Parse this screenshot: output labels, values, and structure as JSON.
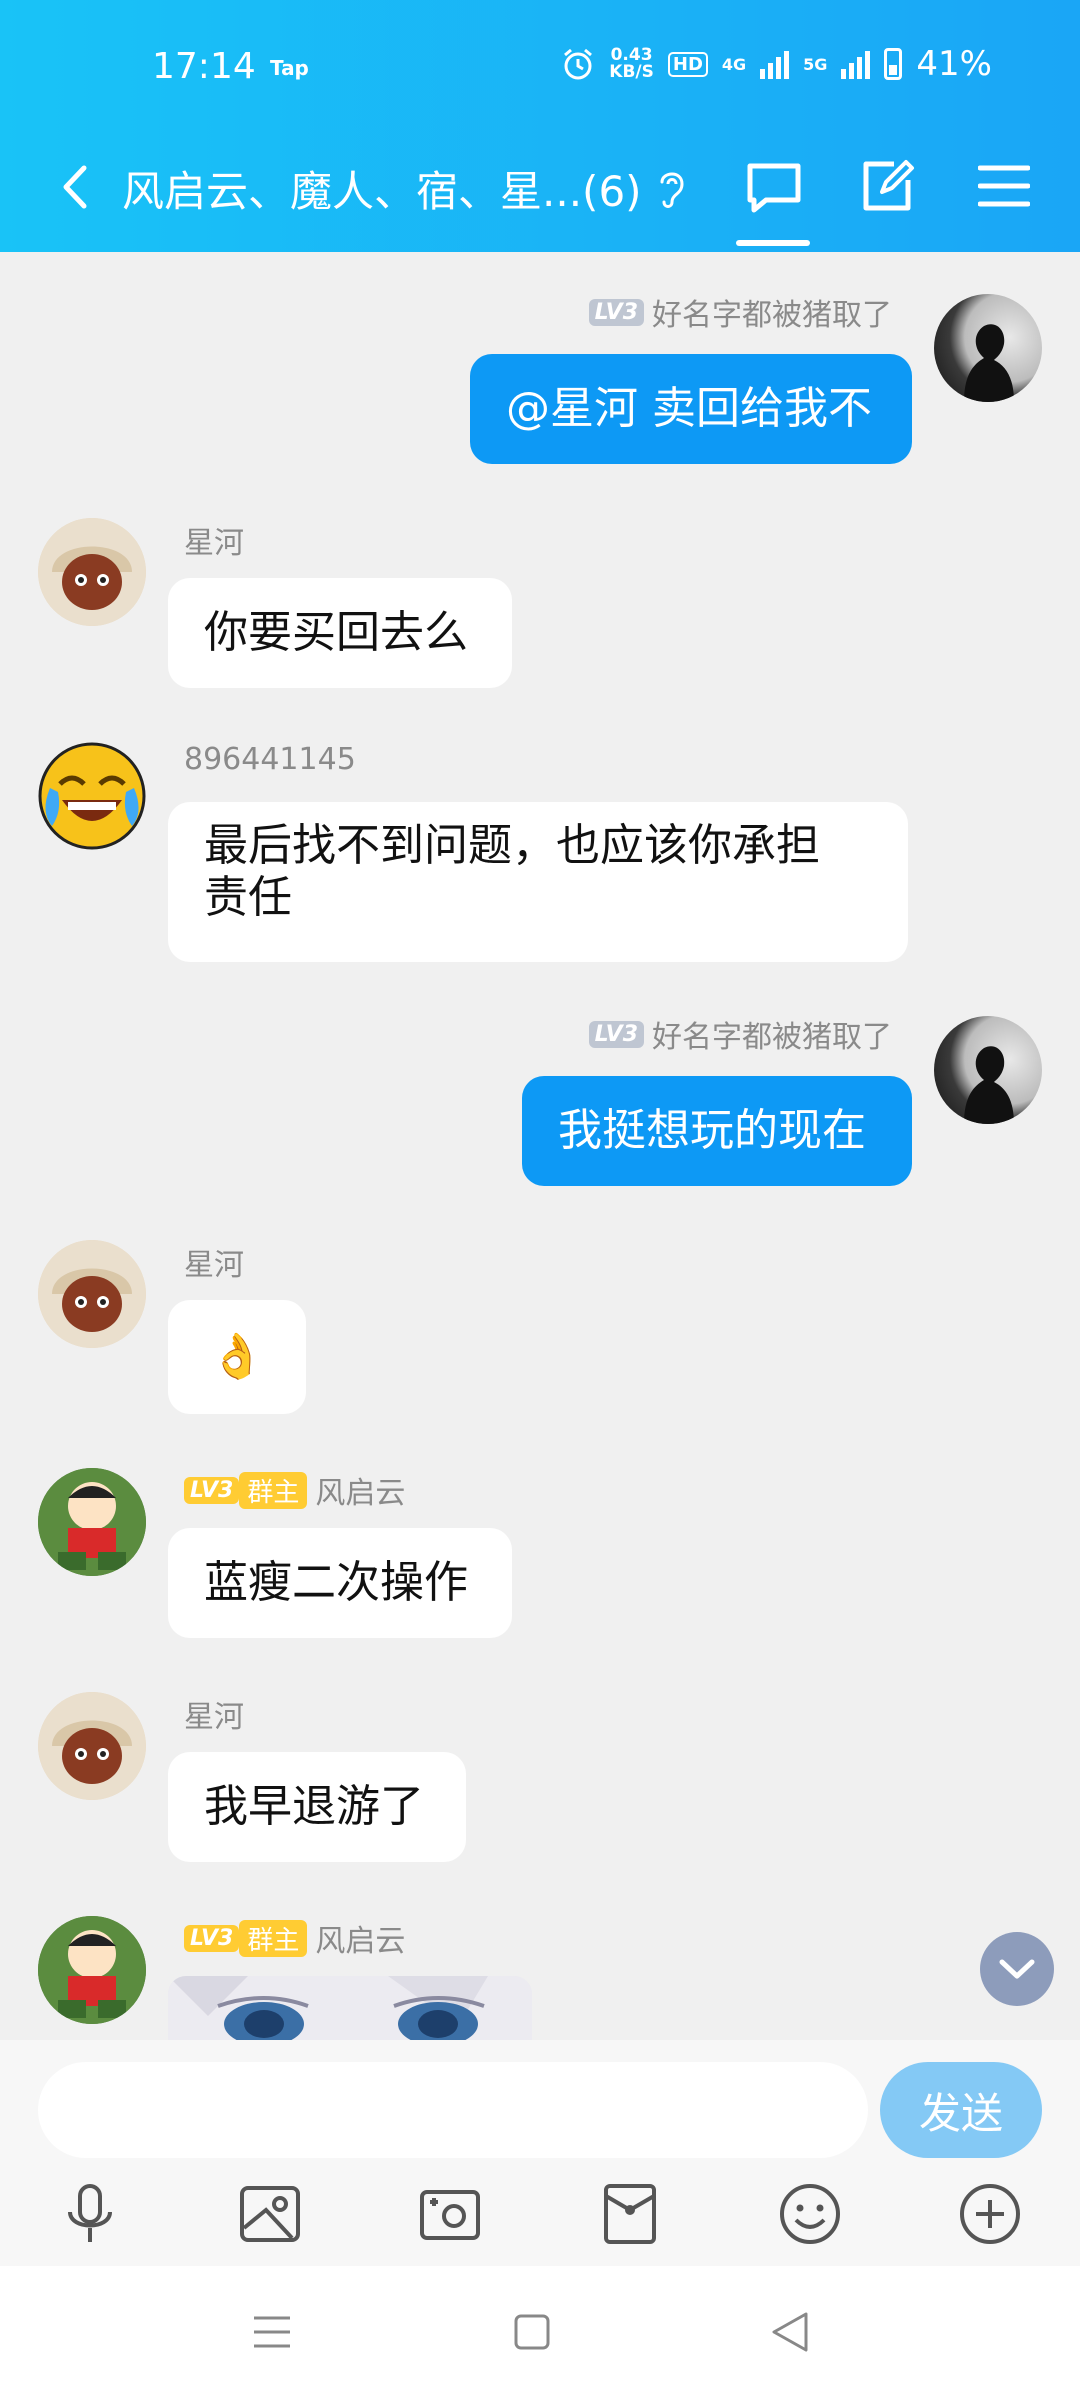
{
  "status_bar": {
    "time": "17:14",
    "extra": "Tap",
    "net_speed": "0.43",
    "net_unit": "KB/S",
    "hd": "HD",
    "net_4g": "4G",
    "net_5g": "5G",
    "battery": "41%"
  },
  "header": {
    "title": "风启云、魔人、宿、星...(6)"
  },
  "messages": [
    {
      "sender": "好名字都被猪取了",
      "level": "LV3",
      "text": "@星河 卖回给我不",
      "side": "out"
    },
    {
      "sender": "星河",
      "text": "你要买回去么",
      "side": "in"
    },
    {
      "sender": "896441145",
      "text_line1": "最后找不到问题，也应该你承担",
      "text_line2": "责任",
      "side": "in"
    },
    {
      "sender": "好名字都被猪取了",
      "level": "LV3",
      "text": "我挺想玩的现在",
      "side": "out"
    },
    {
      "sender": "星河",
      "text": "👌",
      "side": "in"
    },
    {
      "sender": "风启云",
      "level": "LV3",
      "role": "群主",
      "text": "蓝瘦二次操作",
      "side": "in"
    },
    {
      "sender": "星河",
      "text": "我早退游了",
      "side": "in"
    },
    {
      "sender": "风启云",
      "level": "LV3",
      "role": "群主",
      "side": "in",
      "image": "anime-girl-image"
    }
  ],
  "composer": {
    "placeholder": "",
    "send_label": "发送"
  },
  "toolbar_icons": [
    "microphone-icon",
    "image-icon",
    "camera-icon",
    "red-packet-icon",
    "emoji-icon",
    "plus-icon"
  ],
  "colors": {
    "header_gradient_start": "#19c3f7",
    "header_gradient_end": "#1aa6f6",
    "outgoing_bubble": "#0d99f5",
    "send_button": "#84c9f5",
    "owner_badge": "#ffcc33"
  }
}
